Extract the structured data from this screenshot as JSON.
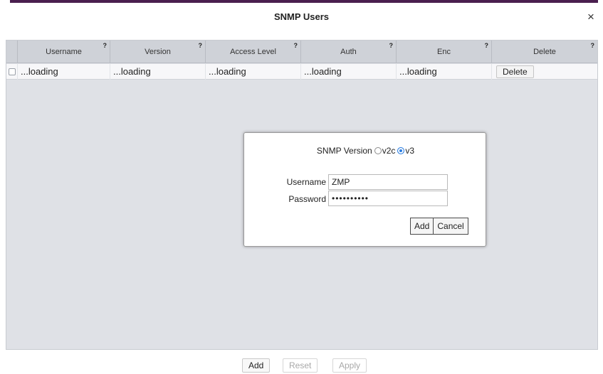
{
  "dialog": {
    "title": "SNMP Users",
    "close_symbol": "×"
  },
  "grid": {
    "columns": [
      {
        "label": "Username",
        "help": "?"
      },
      {
        "label": "Version",
        "help": "?"
      },
      {
        "label": "Access Level",
        "help": "?"
      },
      {
        "label": "Auth",
        "help": "?"
      },
      {
        "label": "Enc",
        "help": "?"
      },
      {
        "label": "Delete",
        "help": "?"
      }
    ],
    "rows": [
      {
        "username": "...loading",
        "version": "...loading",
        "access_level": "...loading",
        "auth": "...loading",
        "enc": "...loading",
        "delete_label": "Delete"
      }
    ]
  },
  "modal": {
    "version_label": "SNMP Version",
    "options": [
      {
        "label": "v2c",
        "selected": false
      },
      {
        "label": "v3",
        "selected": true
      }
    ],
    "username_label": "Username",
    "username_value": "ZMP",
    "password_label": "Password",
    "password_mask": "••••••••••",
    "add_label": "Add",
    "cancel_label": "Cancel"
  },
  "footer": {
    "add_label": "Add",
    "reset_label": "Reset",
    "apply_label": "Apply"
  },
  "colors": {
    "title_stripe": "#4a1f4f",
    "grid_bg": "#dfe1e6",
    "radio_selected": "#2a7de1"
  }
}
